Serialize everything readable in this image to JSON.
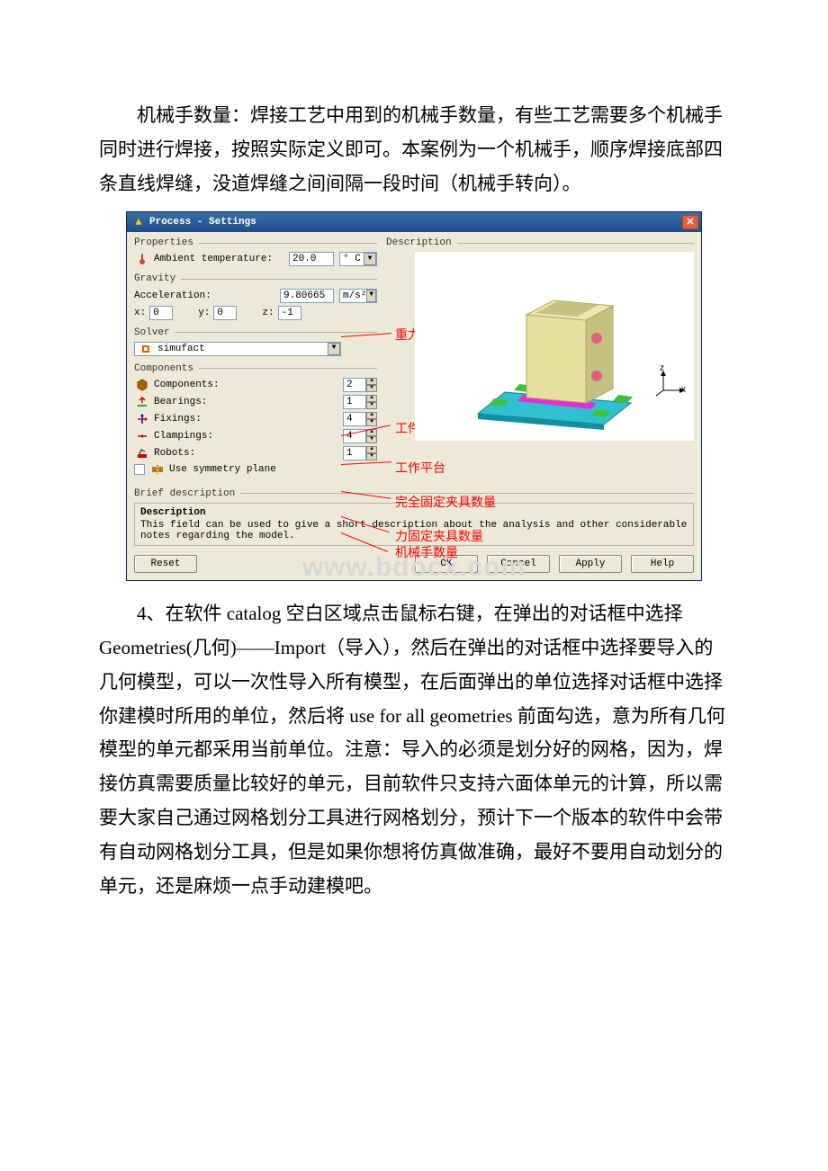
{
  "paragraph_top": "机械手数量：焊接工艺中用到的机械手数量，有些工艺需要多个机械手同时进行焊接，按照实际定义即可。本案例为一个机械手，顺序焊接底部四条直线焊缝，没道焊缝之间间隔一段时间（机械手转向）。",
  "dialog": {
    "title": "Process - Settings",
    "groups": {
      "properties": {
        "title": "Properties",
        "ambient_label": "Ambient temperature:",
        "ambient_value": "20.0",
        "ambient_unit": "° C"
      },
      "gravity": {
        "title": "Gravity",
        "accel_label": "Acceleration:",
        "accel_value": "9.80665",
        "accel_unit": "m/s²",
        "x_label": "x:",
        "x_value": "0",
        "y_label": "y:",
        "y_value": "0",
        "z_label": "z:",
        "z_value": "-1"
      },
      "solver": {
        "title": "Solver",
        "value": "simufact"
      },
      "components": {
        "title": "Components",
        "rows": [
          {
            "label": "Components:",
            "value": "2"
          },
          {
            "label": "Bearings:",
            "value": "1"
          },
          {
            "label": "Fixings:",
            "value": "4"
          },
          {
            "label": "Clampings:",
            "value": "4"
          },
          {
            "label": "Robots:",
            "value": "1"
          }
        ],
        "symmetry_label": "Use symmetry plane"
      }
    },
    "right_title": "Description",
    "brief_title": "Brief description",
    "desc_title": "Description",
    "desc_text": "This field can be used to give a short description about the analysis and other considerable notes regarding the model.",
    "buttons": {
      "reset": "Reset",
      "ok": "OK",
      "cancel": "Cancel",
      "apply": "Apply",
      "help": "Help"
    }
  },
  "annotations": {
    "gravity_dir": "重力方向",
    "workpieces": "工件数",
    "worktable": "工作平台",
    "fixed_clamps": "完全固定夹具数量",
    "force_clamps": "力固定夹具数量",
    "robots": "机械手数量"
  },
  "axes": {
    "x": "x",
    "z": "z"
  },
  "watermark": "www.bdocx.com",
  "paragraph_bottom": "4、在软件 catalog 空白区域点击鼠标右键，在弹出的对话框中选择 Geometries(几何)——Import（导入），然后在弹出的对话框中选择要导入的几何模型，可以一次性导入所有模型，在后面弹出的单位选择对话框中选择你建模时所用的单位，然后将 use for all geometries 前面勾选，意为所有几何模型的单元都采用当前单位。注意：导入的必须是划分好的网格，因为，焊接仿真需要质量比较好的单元，目前软件只支持六面体单元的计算，所以需要大家自己通过网格划分工具进行网格划分，预计下一个版本的软件中会带有自动网格划分工具，但是如果你想将仿真做准确，最好不要用自动划分的单元，还是麻烦一点手动建模吧。"
}
